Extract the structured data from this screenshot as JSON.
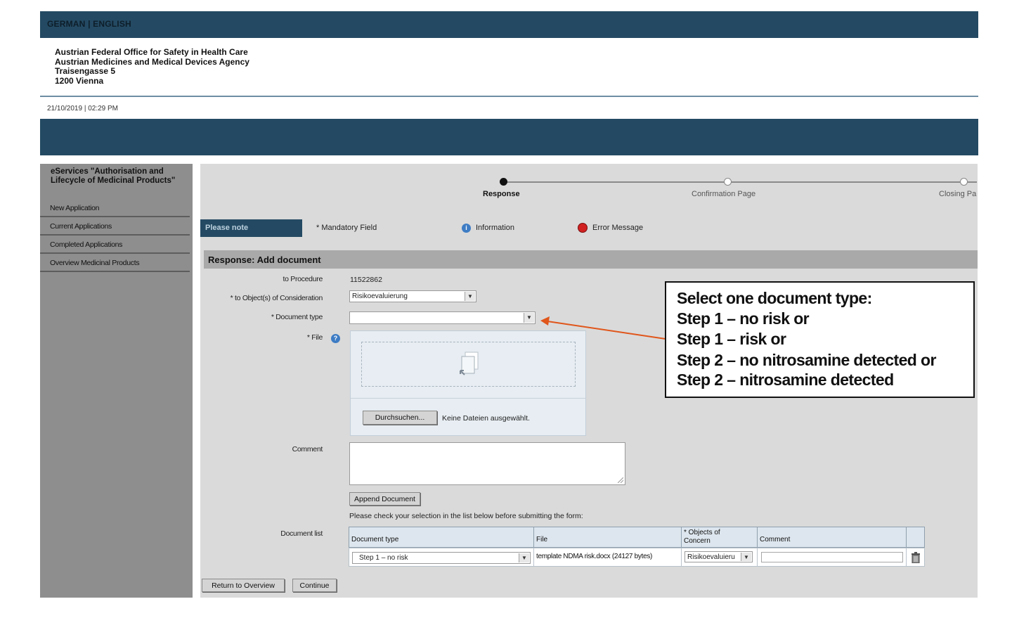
{
  "header": {
    "languages": "GERMAN | ENGLISH",
    "agency_lines": [
      "Austrian Federal Office for Safety in Health Care",
      "Austrian Medicines and Medical Devices Agency",
      "Traisengasse 5",
      "1200 Vienna"
    ],
    "datetime": "21/10/2019 | 02:29 PM"
  },
  "sidebar": {
    "title": "eServices \"Authorisation and Lifecycle of Medicinal Products\"",
    "items": [
      {
        "label": "New Application"
      },
      {
        "label": "Current Applications"
      },
      {
        "label": "Completed Applications"
      },
      {
        "label": "Overview Medicinal Products"
      }
    ]
  },
  "steps": [
    {
      "label": "Response",
      "state": "current"
    },
    {
      "label": "Confirmation Page",
      "state": "pending"
    },
    {
      "label": "Closing Pa",
      "state": "pending"
    }
  ],
  "legend": {
    "please_note": "Please note",
    "mandatory": "* Mandatory Field",
    "information": "Information",
    "error": "Error Message"
  },
  "form": {
    "section_title": "Response: Add document",
    "procedure_label": "to Procedure",
    "procedure_value": "11522862",
    "objects_label": "* to Object(s) of Consideration",
    "objects_value": "Risikoevaluierung",
    "doctype_label": "* Document type",
    "doctype_value": "",
    "file_label": "* File",
    "browse_button": "Durchsuchen...",
    "no_file_text": "Keine Dateien ausgewählt.",
    "comment_label": "Comment",
    "comment_value": "",
    "append_button": "Append Document",
    "check_text": "Please check your selection in the list below before submitting the form:",
    "doclist_label": "Document list"
  },
  "doc_table": {
    "headers": [
      "Document type",
      "File",
      "* Objects of Concern",
      "Comment"
    ],
    "row": {
      "doctype": "Step 1 – no risk",
      "file": "template NDMA risk.docx (24127 bytes)",
      "objects": "Risikoevaluieru",
      "comment": ""
    }
  },
  "actions": {
    "return_button": "Return to Overview",
    "continue_button": "Continue"
  },
  "callout": {
    "lines": [
      "Select one document type:",
      "Step 1 – no risk or",
      "Step 1 – risk or",
      "Step 2 – no nitrosamine detected or",
      "Step 2 – nitrosamine detected"
    ]
  },
  "colors": {
    "header_blue": "#244a63",
    "sidebar_gray": "#8e8e8e",
    "content_gray": "#dadada",
    "arrow_orange": "#e0561b",
    "info_blue": "#3d7cc4",
    "error_red": "#d12121"
  }
}
